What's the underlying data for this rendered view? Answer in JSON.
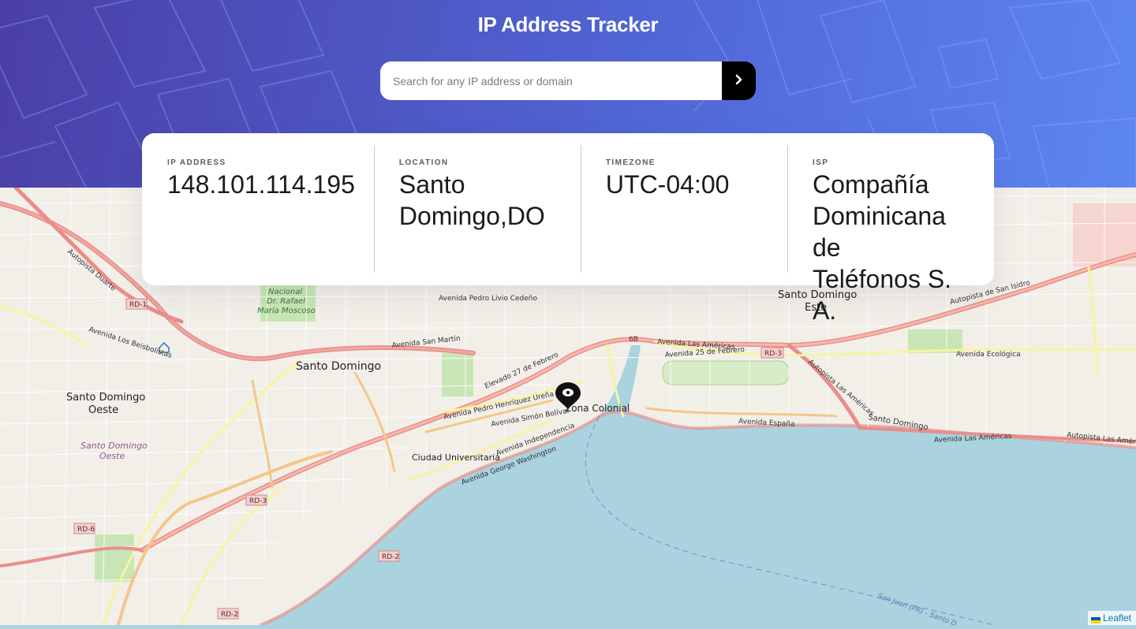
{
  "app": {
    "title": "IP Address Tracker"
  },
  "search": {
    "placeholder": "Search for any IP address or domain",
    "value": ""
  },
  "search_button": {
    "icon": "chevron-right-icon"
  },
  "info": {
    "ip_label": "IP ADDRESS",
    "ip_value": "148.101.114.195",
    "location_label": "LOCATION",
    "location_line1": "Santo",
    "location_line2": "Domingo,DO",
    "timezone_label": "TIMEZONE",
    "timezone_value": "UTC-04:00",
    "isp_label": "ISP",
    "isp_line1": "Compañía",
    "isp_line2": "Dominicana de",
    "isp_line3": "Teléfonos S. A."
  },
  "map": {
    "labels": {
      "santo_domingo": "Santo Domingo",
      "sd_oeste_1": "Santo Domingo",
      "sd_oeste_2": "Oeste",
      "sd_oeste_italic_1": "Santo Domingo",
      "sd_oeste_italic_2": "Oeste",
      "sd_este_1": "Santo Domingo",
      "sd_este_2": "Este",
      "zona_colonial": "Zona Colonial",
      "ciudad_universitaria": "Ciudad Universitaria",
      "park_1": "Nacional",
      "park_2": "Dr. Rafael",
      "park_3": "María Moscoso",
      "av_san_martin": "Avenida San Martín",
      "av_pedro_livio": "Avenida Pedro Livio Cedeño",
      "av_las_americas": "Avenida Las Américas",
      "av_25_feb": "Avenida 25 de Febrero",
      "av_ecologica": "Avenida Ecológica",
      "av_espana": "Avenida España",
      "av_independencia": "Avenida Independencia",
      "av_george_washington": "Avenida George Washington",
      "av_simon_bolivar": "Avenida Simón Bolívar",
      "av_pedro_henriquez": "Avenida Pedro Henríquez Ureña",
      "elevado_27": "Elevado 27 de Febrero",
      "autopista_duarte": "Autopista Duarte",
      "autopista_san_isidro": "Autopista de San Isidro",
      "autopista_las_americas": "Autopista Las Américas",
      "santo_domingo_coast": "Santo Domingo",
      "av_los_beisbolistas": "Avenida Los Beisbolistas",
      "san_juan_ferry": "San Juan (PR) - Santo D",
      "rd1": "RD-1",
      "rd2a": "RD-2",
      "rd2b": "RD-2",
      "rd3a": "RD-3",
      "rd3b": "RD-3",
      "rd6": "RD-6",
      "r6b": "6B"
    },
    "marker_icon": "location-pin-icon",
    "attribution": "Leaflet"
  }
}
